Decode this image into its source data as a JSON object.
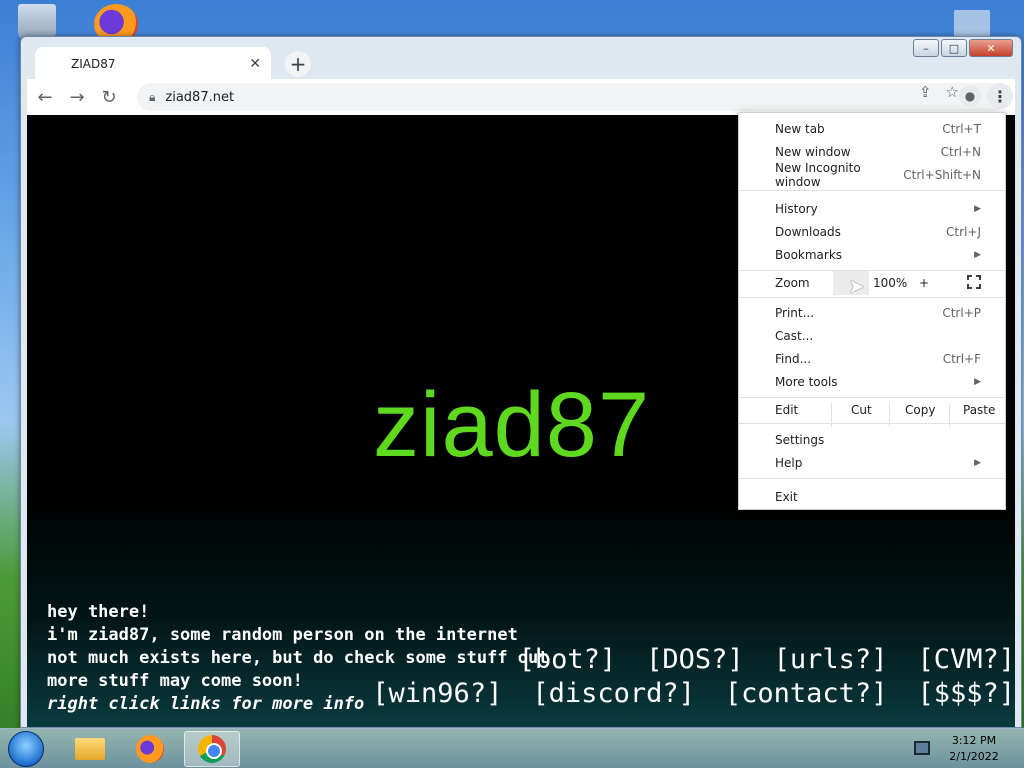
{
  "browser": {
    "tab_title": "ZIAD87",
    "url": "ziad87.net",
    "window_controls": {
      "minimize": "–",
      "maximize": "□",
      "close": "✕"
    }
  },
  "page": {
    "logo": "ziad87",
    "intro_lines": [
      "hey there!",
      "i'm ziad87, some random person on the internet",
      "not much exists here, but do check some stuff out",
      "more stuff may come soon!"
    ],
    "intro_italic": "right click links for more info",
    "links_row1": [
      "[bot?]",
      "[DOS?]",
      "[urls?]",
      "[CVM?]"
    ],
    "links_row2": [
      "[win96?]",
      "[discord?]",
      "[contact?]",
      "[$$$?]"
    ]
  },
  "menu": {
    "new_tab": {
      "label": "New tab",
      "shortcut": "Ctrl+T"
    },
    "new_window": {
      "label": "New window",
      "shortcut": "Ctrl+N"
    },
    "incognito": {
      "label": "New Incognito window",
      "shortcut": "Ctrl+Shift+N"
    },
    "history": {
      "label": "History"
    },
    "downloads": {
      "label": "Downloads",
      "shortcut": "Ctrl+J"
    },
    "bookmarks": {
      "label": "Bookmarks"
    },
    "zoom": {
      "label": "Zoom",
      "value": "100%",
      "plus": "+"
    },
    "print": {
      "label": "Print...",
      "shortcut": "Ctrl+P"
    },
    "cast": {
      "label": "Cast..."
    },
    "find": {
      "label": "Find...",
      "shortcut": "Ctrl+F"
    },
    "more_tools": {
      "label": "More tools"
    },
    "edit": {
      "label": "Edit",
      "cut": "Cut",
      "copy": "Copy",
      "paste": "Paste"
    },
    "settings": {
      "label": "Settings"
    },
    "help": {
      "label": "Help"
    },
    "exit": {
      "label": "Exit"
    }
  },
  "taskbar": {
    "time": "3:12 PM",
    "date": "2/1/2022"
  }
}
